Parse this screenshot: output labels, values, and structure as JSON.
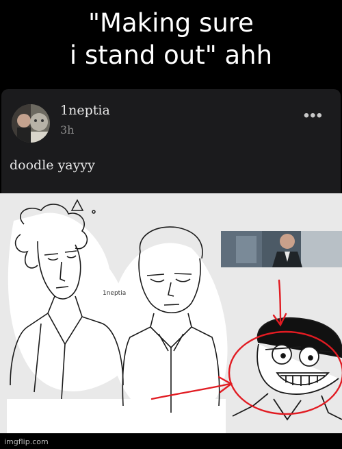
{
  "meme": {
    "caption_line1": "\"Making sure",
    "caption_line2": "i stand out\" ahh"
  },
  "post": {
    "username": "1neptia",
    "time": "3h",
    "text": "doodle yayyy",
    "more_label": "•••",
    "artist_tag": "1neptia"
  },
  "footer": {
    "watermark": "imgflip.com"
  },
  "colors": {
    "annotation_red": "#e11b22",
    "card_bg": "#1b1b1d",
    "art_bg": "#e9e9e9"
  }
}
